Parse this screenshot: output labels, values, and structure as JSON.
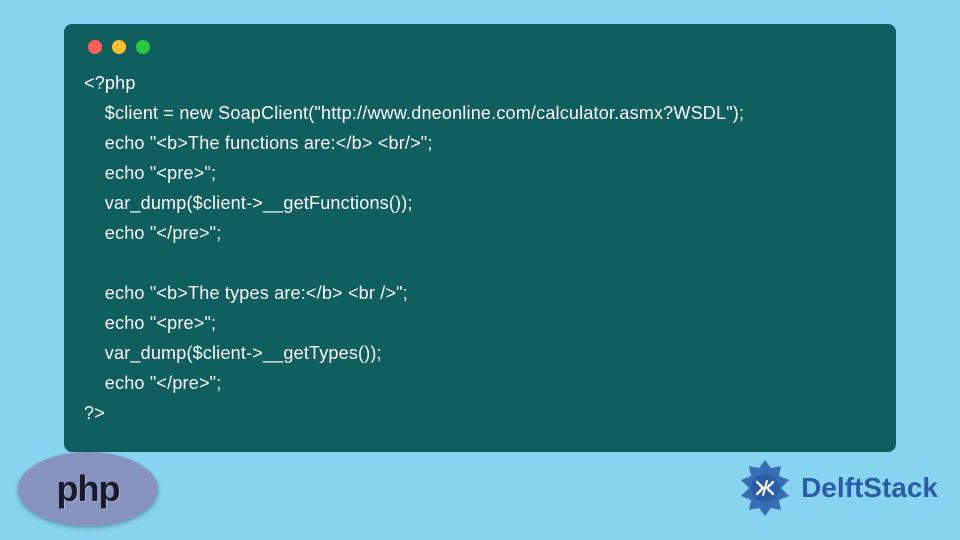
{
  "code": {
    "line1": "<?php",
    "line2": "    $client = new SoapClient(\"http://www.dneonline.com/calculator.asmx?WSDL\");",
    "line3": "    echo \"<b>The functions are:</b> <br/>\";",
    "line4": "    echo \"<pre>\";",
    "line5": "    var_dump($client->__getFunctions());",
    "line6": "    echo \"</pre>\";",
    "line7": "",
    "line8": "    echo \"<b>The types are:</b> <br />\";",
    "line9": "    echo \"<pre>\";",
    "line10": "    var_dump($client->__getTypes());",
    "line11": "    echo \"</pre>\";",
    "line12": "?>"
  },
  "logos": {
    "php_label": "php",
    "delft_label": "DelftStack"
  },
  "colors": {
    "background": "#87d4f0",
    "code_window": "#0f5f5f",
    "code_text": "#ffffff",
    "php_ellipse": "#8892bf",
    "delft_blue": "#2a5ca8"
  }
}
